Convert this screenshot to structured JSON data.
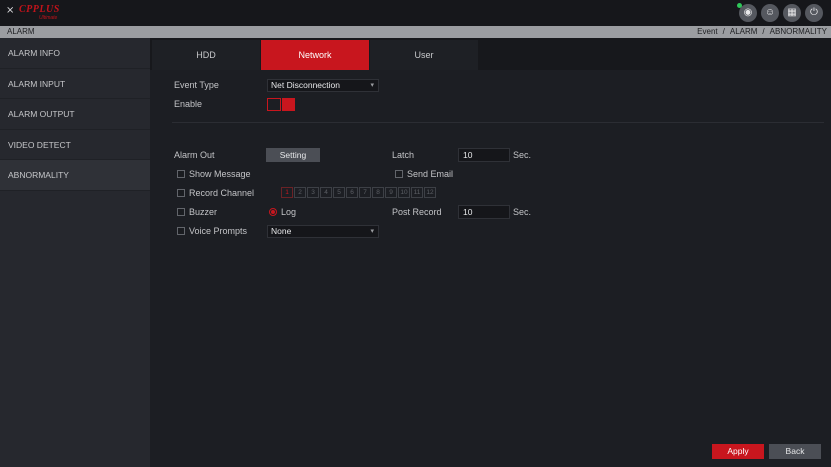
{
  "brand": {
    "name": "CPPLUS",
    "sub": "Ultimate"
  },
  "top_icons": [
    "eye-icon",
    "user-icon",
    "layout-icon",
    "power-icon"
  ],
  "titlebar": {
    "title": "ALARM",
    "breadcrumb": [
      "Event",
      "/",
      "ALARM",
      "/",
      "ABNORMALITY"
    ]
  },
  "sidebar": {
    "items": [
      {
        "label": "ALARM INFO"
      },
      {
        "label": "ALARM INPUT"
      },
      {
        "label": "ALARM OUTPUT"
      },
      {
        "label": "VIDEO DETECT"
      },
      {
        "label": "ABNORMALITY",
        "active": true
      }
    ]
  },
  "tabs": [
    {
      "label": "HDD"
    },
    {
      "label": "Network",
      "active": true
    },
    {
      "label": "User"
    }
  ],
  "form": {
    "event_type_label": "Event Type",
    "event_type_value": "Net Disconnection",
    "enable_label": "Enable",
    "enable_state": true,
    "alarm_out_label": "Alarm Out",
    "setting_label": "Setting",
    "latch_label": "Latch",
    "latch_value": "10",
    "latch_unit": "Sec.",
    "show_message_label": "Show Message",
    "send_email_label": "Send Email",
    "record_channel_label": "Record Channel",
    "channels": [
      "1",
      "2",
      "3",
      "4",
      "5",
      "6",
      "7",
      "8",
      "9",
      "10",
      "11",
      "12"
    ],
    "buzzer_label": "Buzzer",
    "log_label": "Log",
    "post_record_label": "Post Record",
    "post_record_value": "10",
    "post_record_unit": "Sec.",
    "voice_prompts_label": "Voice Prompts",
    "voice_prompts_value": "None"
  },
  "footer": {
    "apply_label": "Apply",
    "back_label": "Back"
  },
  "colors": {
    "accent": "#c8161e",
    "background": "#1c1e23",
    "sidebar": "#26282e",
    "titlebar": "#9b9da1"
  }
}
